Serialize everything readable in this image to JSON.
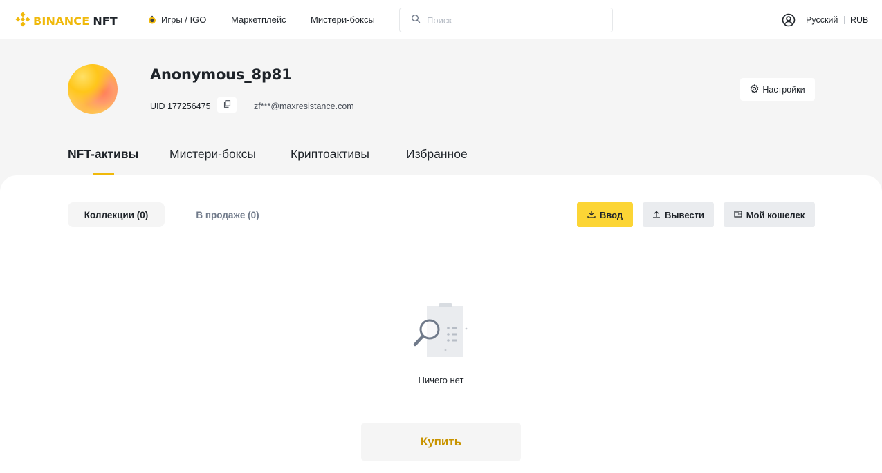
{
  "header": {
    "logo_text": "BINANCE",
    "logo_suffix": "NFT",
    "nav": {
      "games": "Игры / IGO",
      "marketplace": "Маркетплейс",
      "mystery_boxes": "Мистери-боксы"
    },
    "search_placeholder": "Поиск",
    "language": "Русский",
    "currency": "RUB"
  },
  "profile": {
    "username": "Anonymous_8p81",
    "uid": "UID 177256475",
    "email": "zf***@maxresistance.com",
    "settings_label": "Настройки"
  },
  "tabs": {
    "nft_assets": "NFT-активы",
    "mystery_boxes": "Мистери-боксы",
    "crypto_assets": "Криптоактивы",
    "favorites": "Избранное"
  },
  "content": {
    "collections_label": "Коллекции (0)",
    "on_sale_label": "В продаже (0)",
    "deposit_label": "Ввод",
    "withdraw_label": "Вывести",
    "wallet_label": "Мой кошелек",
    "empty_text": "Ничего нет",
    "buy_label": "Купить"
  },
  "colors": {
    "brand": "#f0b90b",
    "deposit_bg": "#fcd535",
    "buy_text": "#c99400"
  },
  "icons": {
    "logo": "binance-logo-icon",
    "games": "game-icon",
    "search": "search-icon",
    "user": "user-icon",
    "copy": "copy-icon",
    "settings": "gear-icon",
    "deposit": "download-icon",
    "withdraw": "upload-icon",
    "wallet": "wallet-icon",
    "empty": "empty-search-illustration"
  }
}
